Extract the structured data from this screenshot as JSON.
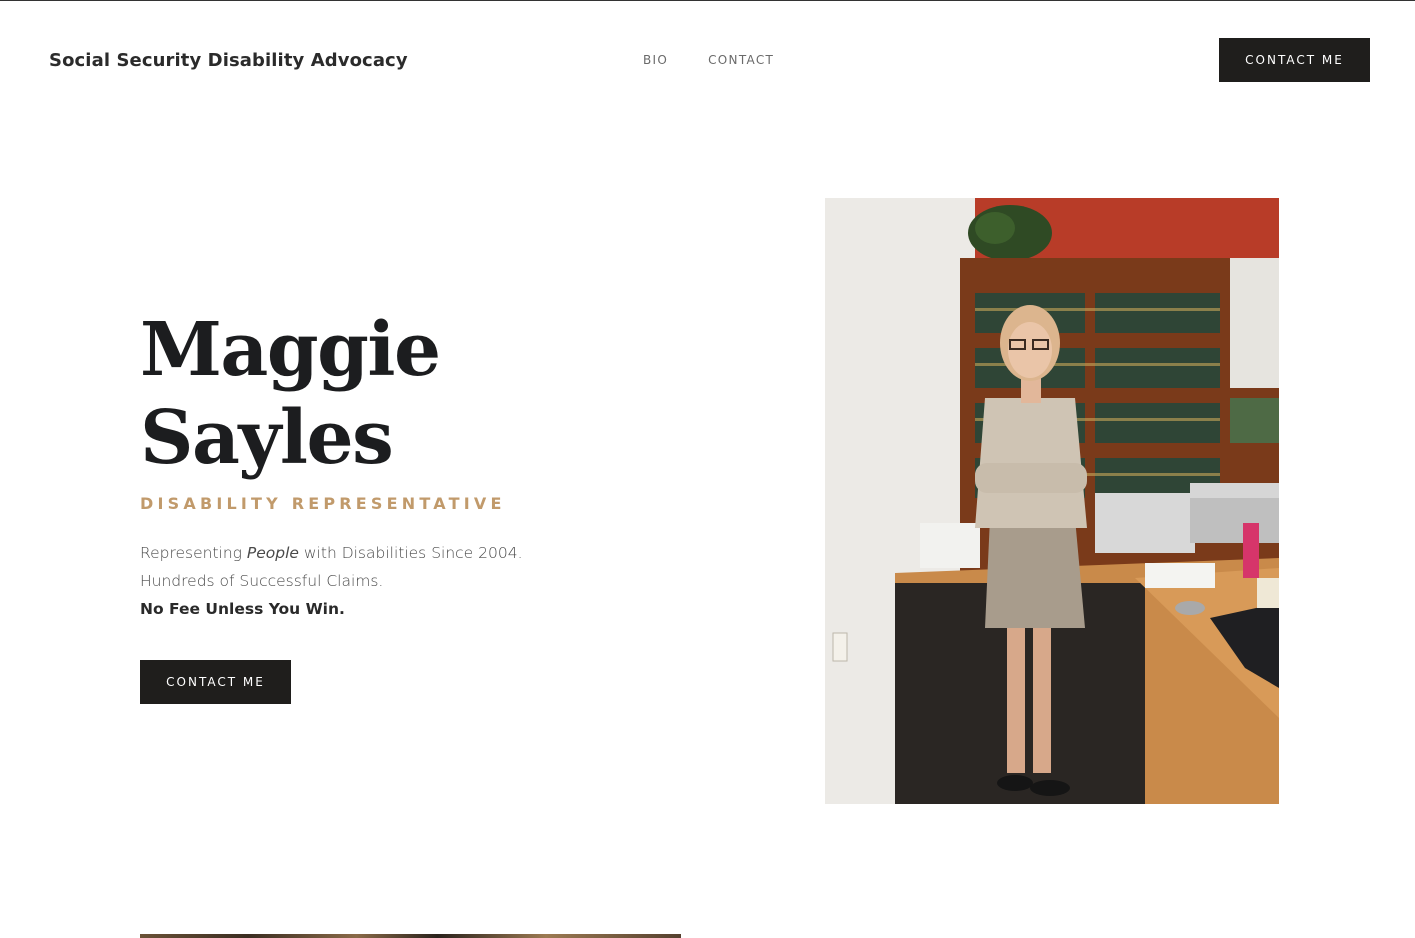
{
  "header": {
    "brand": "Social Security Disability Advocacy",
    "nav": [
      {
        "label": "BIO"
      },
      {
        "label": "CONTACT"
      }
    ],
    "cta_label": "CONTACT ME"
  },
  "hero": {
    "name_line1": "Maggie",
    "name_line2": "Sayles",
    "subtitle": "DISABILITY REPRESENTATIVE",
    "body": {
      "line1_prefix": "Representing ",
      "line1_emph": "People",
      "line1_suffix": " with Disabilities Since 2004.",
      "line2": "Hundreds of Successful Claims.",
      "line3": "No Fee Unless You Win."
    },
    "cta_label": "CONTACT ME"
  },
  "colors": {
    "accent_gold": "#c19a6b",
    "button_dark": "#1f1e1c",
    "heading_dark": "#1c1d1f"
  }
}
